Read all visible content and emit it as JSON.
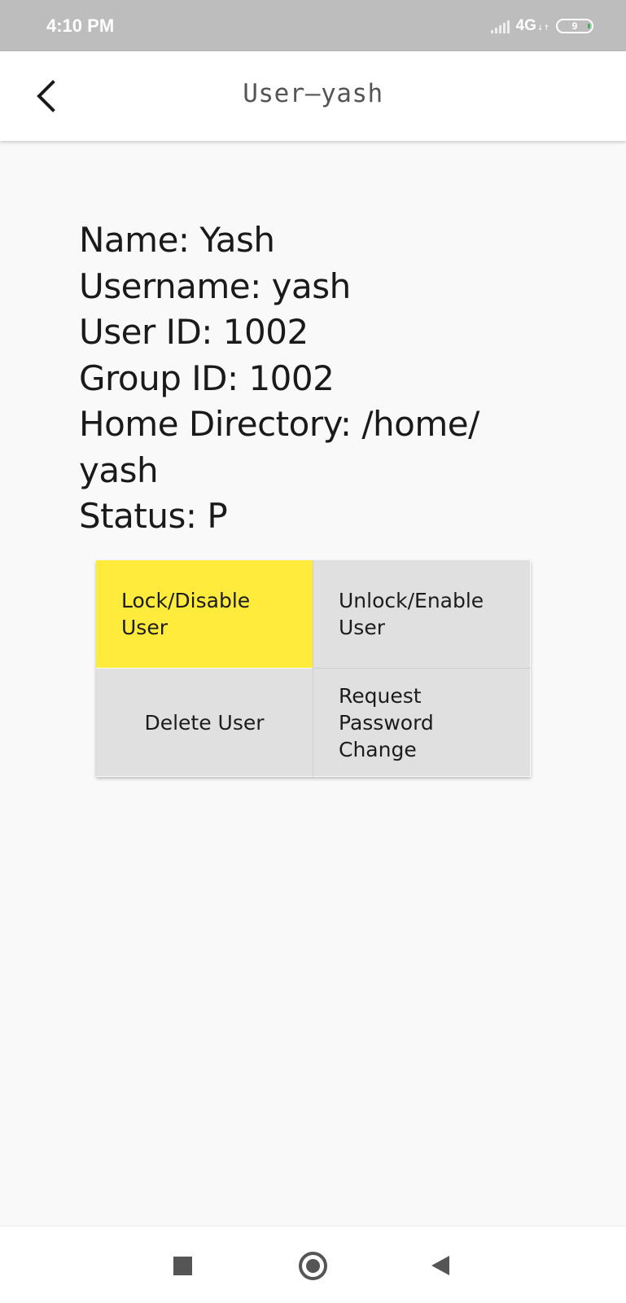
{
  "status_bar": {
    "time": "4:10 PM",
    "network": "4G",
    "network_arrows": "↓↑",
    "battery_level": "9",
    "icons": [
      "signal-icon",
      "battery-icon"
    ]
  },
  "app_bar": {
    "title": "User–yash",
    "back_icon": "chevron-left-icon"
  },
  "user_info": {
    "name_line": "Name: Yash",
    "username_line": "Username: yash",
    "user_id_line": "User ID: 1002",
    "group_id_line": "Group ID: 1002",
    "home_dir_line_1": "Home Directory: /home/",
    "home_dir_line_2": "yash",
    "status_line": "Status: P"
  },
  "actions": {
    "lock_line_1": "Lock/Disable",
    "lock_line_2": "User",
    "unlock_line_1": "Unlock/Enable",
    "unlock_line_2": "User",
    "delete": "Delete User",
    "request_line_1": "Request",
    "request_line_2": "Password",
    "request_line_3": "Change"
  },
  "colors": {
    "accent_button": "#ffeb3b",
    "button_bg": "#e0e0e0",
    "status_bar_bg": "#bdbdbd",
    "page_bg": "#f9f9f9"
  },
  "nav_bar": {
    "icons": [
      "recents-square-icon",
      "home-circle-icon",
      "back-triangle-icon"
    ]
  }
}
